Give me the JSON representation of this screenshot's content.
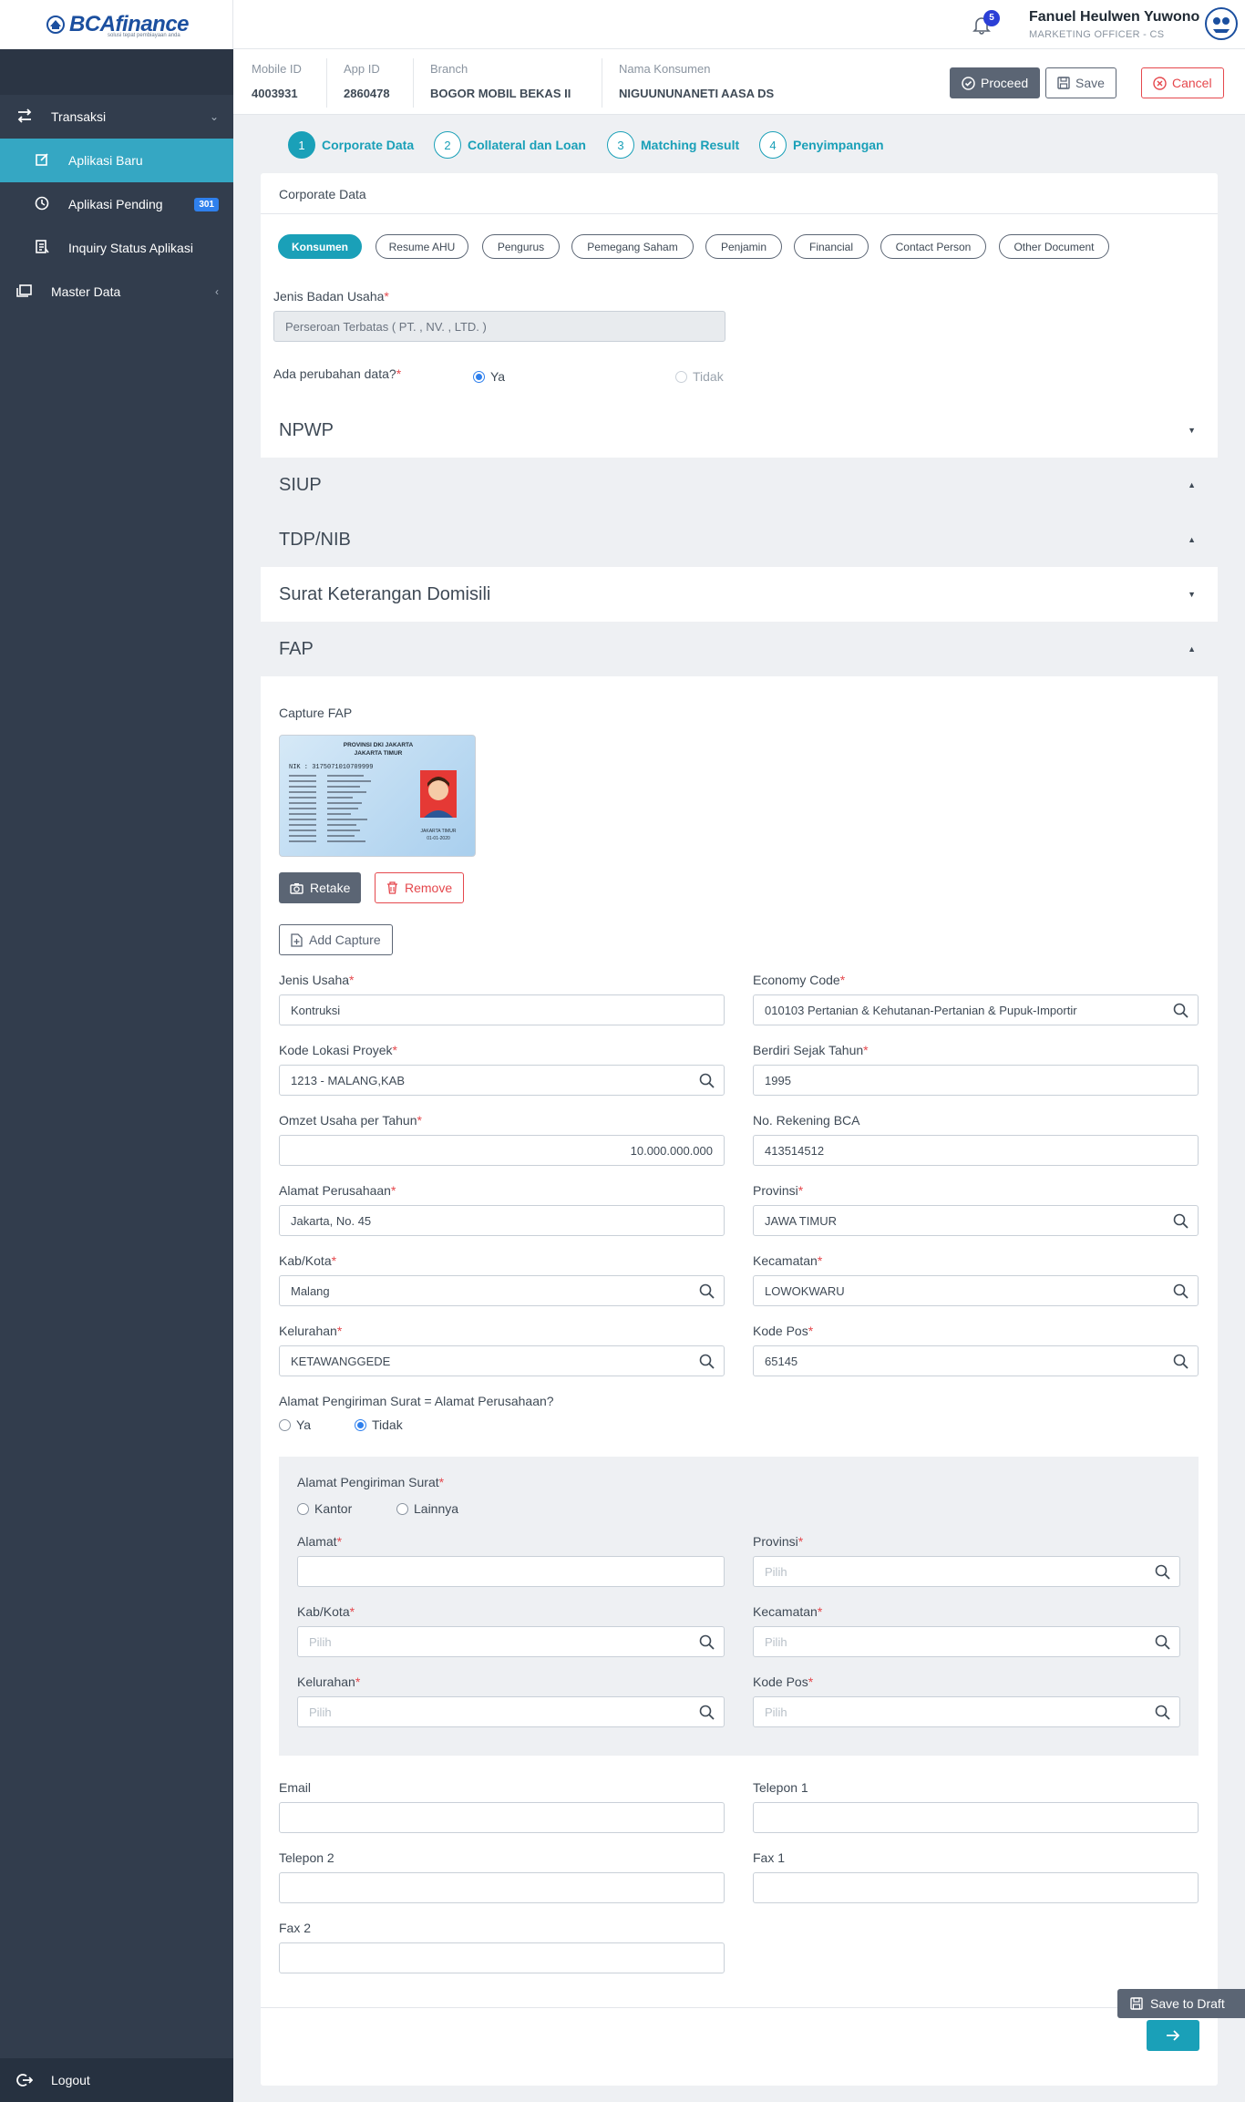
{
  "app": {
    "logo_text": "BCAfinance",
    "logo_tagline": "solusi tepat pembiayaan anda"
  },
  "sidebar": {
    "items": [
      {
        "label": "Transaksi",
        "icon": "transfer-icon",
        "chevron": "⌄"
      },
      {
        "label": "Aplikasi Baru",
        "icon": "edit-icon"
      },
      {
        "label": "Aplikasi Pending",
        "icon": "clock-icon",
        "badge": "301"
      },
      {
        "label": "Inquiry Status Aplikasi",
        "icon": "document-icon"
      },
      {
        "label": "Master Data",
        "icon": "layers-icon",
        "chevron": "‹"
      }
    ],
    "logout": "Logout"
  },
  "header": {
    "notification_count": "5",
    "user_name": "Fanuel Heulwen Yuwono",
    "user_role": "MARKETING OFFICER - CS"
  },
  "info": {
    "mobile_id_label": "Mobile ID",
    "mobile_id": "4003931",
    "app_id_label": "App ID",
    "app_id": "2860478",
    "branch_label": "Branch",
    "branch": "BOGOR MOBIL BEKAS II",
    "nama_label": "Nama Konsumen",
    "nama": "NIGUUNUNANETI AASA DS"
  },
  "actions": {
    "proceed": "Proceed",
    "save": "Save",
    "cancel": "Cancel"
  },
  "steps": [
    {
      "num": "1",
      "label": "Corporate Data"
    },
    {
      "num": "2",
      "label": "Collateral dan Loan"
    },
    {
      "num": "3",
      "label": "Matching Result"
    },
    {
      "num": "4",
      "label": "Penyimpangan"
    }
  ],
  "card": {
    "title": "Corporate Data",
    "tabs": [
      "Konsumen",
      "Resume AHU",
      "Pengurus",
      "Pemegang Saham",
      "Penjamin",
      "Financial",
      "Contact Person",
      "Other Document"
    ]
  },
  "form": {
    "jenis_badan_label": "Jenis Badan Usaha",
    "jenis_badan_value": "Perseroan Terbatas ( PT. , NV. , LTD. )",
    "perubahan_label": "Ada perubahan data?",
    "perubahan_ya": "Ya",
    "perubahan_tidak": "Tidak",
    "sections": [
      "NPWP",
      "SIUP",
      "TDP/NIB",
      "Surat Keterangan Domisili",
      "FAP"
    ],
    "capture_label": "Capture FAP",
    "retake": "Retake",
    "remove": "Remove",
    "add_capture": "Add Capture",
    "jenis_usaha_label": "Jenis Usaha",
    "jenis_usaha": "Kontruksi",
    "economy_code_label": "Economy Code",
    "economy_code": "010103 Pertanian & Kehutanan-Pertanian & Pupuk-Importir",
    "kode_lokasi_label": "Kode Lokasi Proyek",
    "kode_lokasi": "1213 - MALANG,KAB",
    "berdiri_label": "Berdiri Sejak Tahun",
    "berdiri": "1995",
    "omzet_label": "Omzet Usaha per Tahun",
    "omzet": "10.000.000.000",
    "rekening_label": "No. Rekening BCA",
    "rekening": "413514512",
    "alamat_label": "Alamat Perusahaan",
    "alamat": "Jakarta, No. 45",
    "provinsi_label": "Provinsi",
    "provinsi": "JAWA TIMUR",
    "kabkota_label": "Kab/Kota",
    "kabkota": "Malang",
    "kecamatan_label": "Kecamatan",
    "kecamatan": "LOWOKWARU",
    "kelurahan_label": "Kelurahan",
    "kelurahan": "KETAWANGGEDE",
    "kodepos_label": "Kode Pos",
    "kodepos": "65145",
    "same_address_label": "Alamat Pengiriman Surat = Alamat Perusahaan?",
    "same_ya": "Ya",
    "same_tidak": "Tidak"
  },
  "shipping": {
    "title": "Alamat Pengiriman Surat",
    "kantor": "Kantor",
    "lainnya": "Lainnya",
    "alamat_label": "Alamat",
    "provinsi_label": "Provinsi",
    "kabkota_label": "Kab/Kota",
    "kecamatan_label": "Kecamatan",
    "kelurahan_label": "Kelurahan",
    "kodepos_label": "Kode Pos",
    "placeholder": "Pilih"
  },
  "contact": {
    "email_label": "Email",
    "telepon1_label": "Telepon 1",
    "telepon2_label": "Telepon 2",
    "fax1_label": "Fax 1",
    "fax2_label": "Fax 2"
  },
  "footer": {
    "save_draft": "Save to Draft"
  },
  "ktp": {
    "province": "PROVINSI DKI JAKARTA",
    "city": "JAKARTA TIMUR",
    "nik": "NIK : 3175071010709999",
    "place": "JAKARTA TIMUR",
    "date": "01-01-2020"
  },
  "colors": {
    "accent": "#1aa0b8",
    "sidebar": "#323d4d",
    "active_item": "#35a7c3",
    "danger": "#e5484d",
    "brand": "#1b4f9f"
  }
}
